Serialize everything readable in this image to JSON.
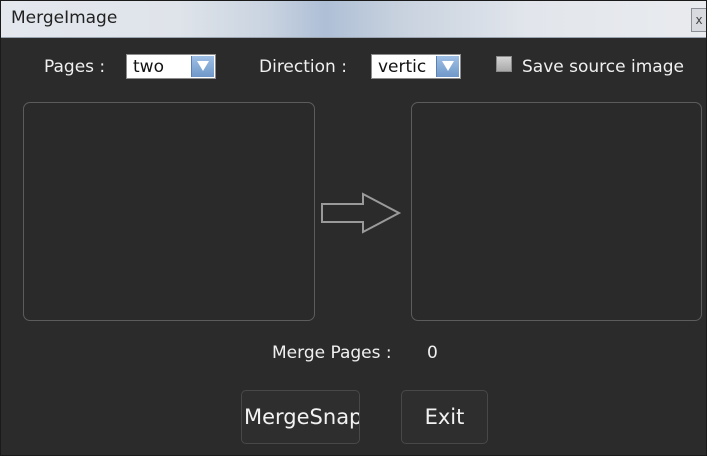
{
  "window": {
    "title": "MergeImage",
    "close_glyph": "x"
  },
  "options": {
    "pages_label": "Pages :",
    "pages_value": "two",
    "direction_label": "Direction :",
    "direction_value": "vertic",
    "save_source_label": "Save source image",
    "save_source_checked": false
  },
  "merge": {
    "pages_label": "Merge Pages :",
    "pages_count": "0"
  },
  "buttons": {
    "merge_label": "MergeSnap",
    "exit_label": "Exit"
  },
  "icons": {
    "flow_arrow": "right-arrow-icon",
    "dropdown": "chevron-down-icon",
    "close": "close-icon"
  }
}
